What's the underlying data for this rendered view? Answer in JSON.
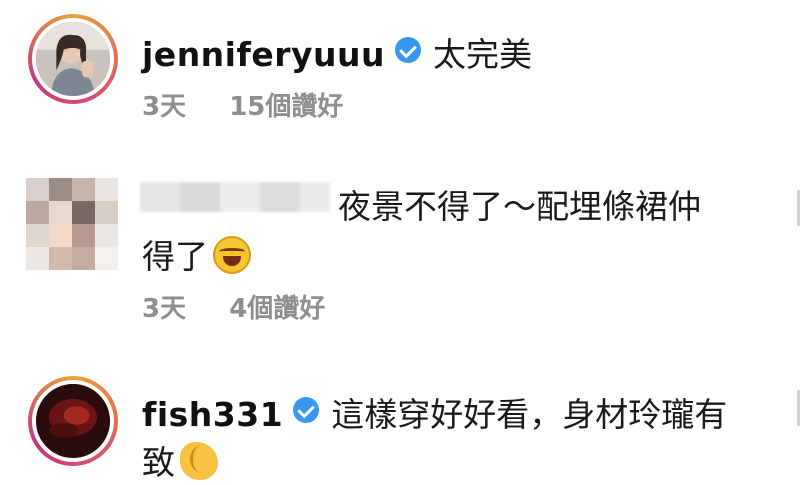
{
  "comments": [
    {
      "username": "jenniferyuuu",
      "verified": true,
      "text": "太完美",
      "time": "3天",
      "likes": "15個讚好"
    },
    {
      "username": "",
      "verified": false,
      "text_line1": "夜景不得了～配埋條裙仲",
      "text_line2": "得了",
      "emoji": "laughing-tears-icon",
      "time": "3天",
      "likes": "4個讚好"
    },
    {
      "username": "fish331",
      "verified": true,
      "text_line1": "這樣穿好好看，身材玲瓏有",
      "text_line2": "致",
      "emoji": "clapping-hands-icon"
    }
  ],
  "colors": {
    "verified": "#3897f0",
    "meta_text": "#8e8e8e",
    "ring": "#e15b64"
  }
}
